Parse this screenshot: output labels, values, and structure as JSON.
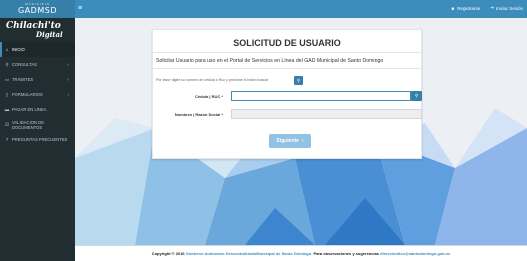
{
  "brand": {
    "sub": "MUNICIPIO",
    "name": "GADMSD"
  },
  "topbar": {
    "menu_toggle": "≡",
    "register": "Registrarse",
    "login": "Iniciar Sesión",
    "accent": "#3c8dbc"
  },
  "logo": {
    "line1": "Chilachi'to",
    "line2": "Digital"
  },
  "sidebar": {
    "items": [
      {
        "label": "INICIO",
        "icon": "home-icon",
        "glyph": "⌂"
      },
      {
        "label": "CONSULTAS",
        "icon": "search-icon",
        "glyph": "⚲"
      },
      {
        "label": "TRÁMITES",
        "icon": "folder-icon",
        "glyph": "▭"
      },
      {
        "label": "FORMULARIOS",
        "icon": "file-icon",
        "glyph": "▯"
      },
      {
        "label": "PAGAR EN LÍNEA",
        "icon": "credit-card-icon",
        "glyph": "▬"
      },
      {
        "label": "VALIDACION DE DOCUMENTOS",
        "icon": "check-square-icon",
        "glyph": "☑"
      },
      {
        "label": "PREGUNTAS FRECUENTES",
        "icon": "question-circle-icon",
        "glyph": "?"
      }
    ],
    "chevron": "‹"
  },
  "form": {
    "title": "SOLICITUD DE USUARIO",
    "intro": "Solicitar Usuario para uso en el Portal de Servicios en Línea del GAD Municipal de Santo Domingo",
    "hint": "Por favor digite su número de cédula o Ruc y presione el botón buscar",
    "cedula_label": "Cédula | RUC *",
    "cedula_value": "",
    "nombres_label": "Nombres | Razón Social *",
    "nombres_value": "",
    "submit_label": "Siguiente",
    "submit_icon": "›"
  },
  "footer": {
    "prefix": "Copyright © 2016",
    "org": "Gobierno Autónomo DescentralizadoMunicipal de Santo Domingo.",
    "middle": "Para observaciones y sugerencias",
    "email": "direcciontics@santodomingo.gob.ec"
  }
}
